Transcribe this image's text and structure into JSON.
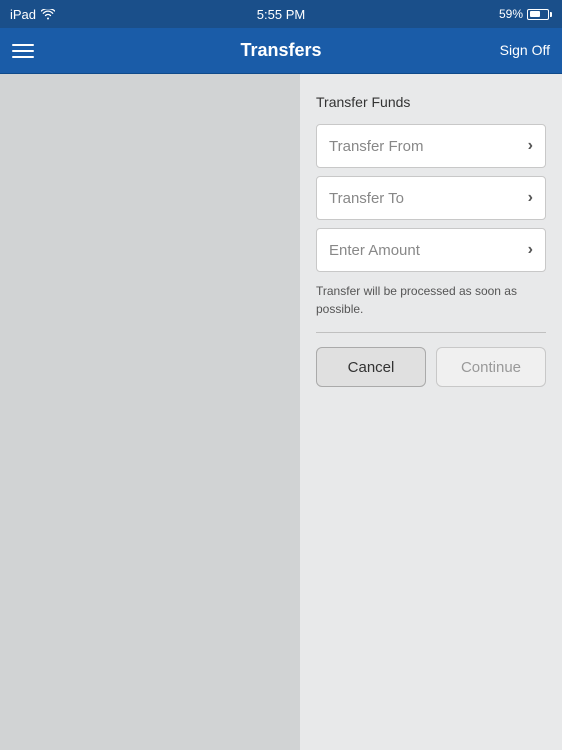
{
  "statusBar": {
    "device": "iPad",
    "time": "5:55 PM",
    "battery": "59%"
  },
  "navBar": {
    "title": "Transfers",
    "signOff": "Sign Off"
  },
  "form": {
    "sectionTitle": "Transfer Funds",
    "transferFrom": "Transfer From",
    "transferTo": "Transfer To",
    "enterAmount": "Enter Amount",
    "infoText": "Transfer will be processed as soon as possible.",
    "cancelLabel": "Cancel",
    "continueLabel": "Continue"
  }
}
